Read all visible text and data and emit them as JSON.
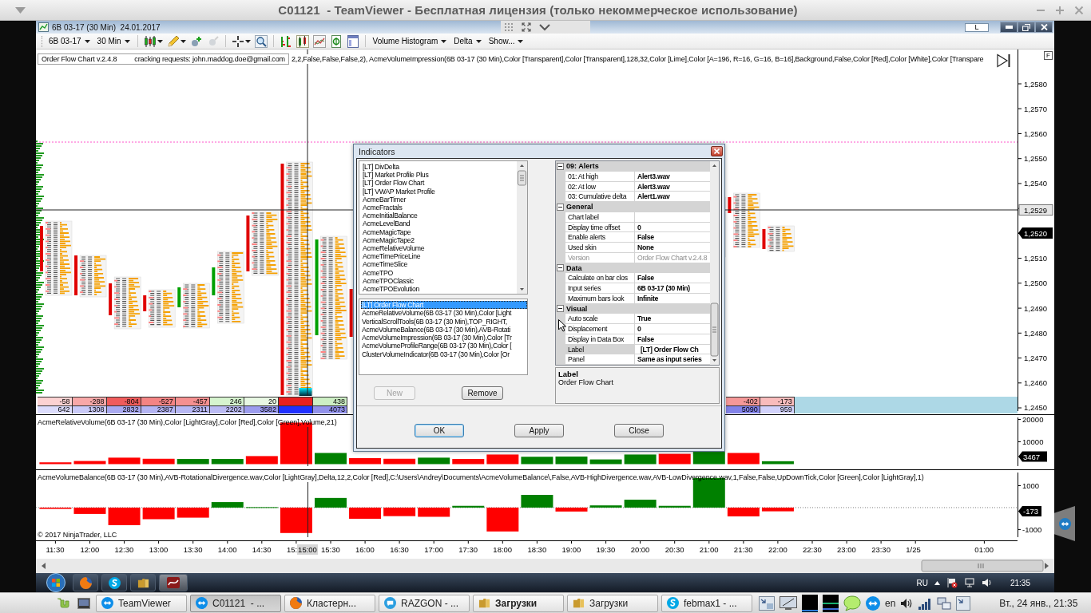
{
  "teamviewer_window": {
    "title": "C01121  - TeamViewer - Бесплатная лицензия (только некоммерческое использование)"
  },
  "chart_window": {
    "title": "6B 03-17 (30 Min)  24.01.2017",
    "layout_button": "L"
  },
  "toolbar": {
    "instrument": "6B 03-17",
    "interval": "30 Min",
    "menus": [
      "Volume Histogram",
      "Delta",
      "Show..."
    ]
  },
  "price_panel": {
    "indicator_box": [
      "Order Flow Chart v.2.4.8",
      "cracking requests: john.maddog.doe@gmail.com"
    ],
    "parameters": "2,2,False,False,False,2), AcmeVolumeImpression(6B 03-17 (30 Min),Color [Transparent],Color [Transparent],128,32,Color [Lime],Color [A=196, R=16, G=16, B=16],Background,False,Color [Red],Color [White],Color [Transpare",
    "corner_label": "F",
    "price_axis": {
      "upper": [
        "1,2580",
        "1,2570",
        "1,2560",
        "1,2550",
        "1,2540"
      ],
      "lower": [
        "1,2510",
        "1,2500",
        "1,2490",
        "1,2480",
        "1,2470",
        "1,2460",
        "1,2450"
      ]
    },
    "crosshair_price": "1,2529",
    "last_price": "1,2520",
    "delta_row": {
      "left": [
        {
          "text": "-58",
          "color": "#fcd2d2"
        },
        {
          "text": "-288",
          "color": "#f8a8a8"
        },
        {
          "text": "-804",
          "color": "#f05c5c"
        },
        {
          "text": "-527",
          "color": "#f48484"
        },
        {
          "text": "-457",
          "color": "#f59090"
        },
        {
          "text": "246",
          "color": "#d6f4cf"
        },
        {
          "text": "20",
          "color": "#e8f8e3"
        },
        {
          "color": "#e82020"
        },
        {
          "text": "438",
          "color": "#cdefc4"
        }
      ],
      "right": [
        {
          "text": "-402",
          "color": "#f59898"
        },
        {
          "text": "-173",
          "color": "#f9bcbc"
        }
      ]
    },
    "volume_row": {
      "left": [
        {
          "text": "642",
          "color": "#dcdcfc"
        },
        {
          "text": "1308",
          "color": "#cacaf8"
        },
        {
          "text": "2832",
          "color": "#a9a9f0"
        },
        {
          "text": "2387",
          "color": "#b4b4f3"
        },
        {
          "text": "2311",
          "color": "#b7b7f3"
        },
        {
          "text": "2202",
          "color": "#bbbbf4"
        },
        {
          "text": "3582",
          "color": "#9c9cee"
        },
        {
          "color": "#2030ff"
        },
        {
          "text": "4073",
          "color": "#9292eb"
        }
      ],
      "right": [
        {
          "text": "5090",
          "color": "#8282e8"
        },
        {
          "text": "959",
          "color": "#d2d2fb"
        }
      ]
    }
  },
  "relative_volume_panel": {
    "label": "AcmeRelativeVolume(6B 03-17 (30 Min),Color [LightGray],Color [Red],Color [Green],Volume,21)",
    "last_value": "3467",
    "chart_data": {
      "type": "bar",
      "x": [
        "2017-01-24T11:30",
        "2017-01-24T12:00",
        "2017-01-24T12:30",
        "2017-01-24T13:00",
        "2017-01-24T13:30",
        "2017-01-24T14:00",
        "2017-01-24T14:30",
        "2017-01-24T15:00",
        "2017-01-24T15:30",
        "2017-01-24T16:00",
        "2017-01-24T16:30",
        "2017-01-24T17:00",
        "2017-01-24T17:30",
        "2017-01-24T18:00",
        "2017-01-24T18:30",
        "2017-01-24T19:00",
        "2017-01-24T19:30",
        "2017-01-24T20:00",
        "2017-01-24T20:30",
        "2017-01-24T21:00",
        "2017-01-24T21:30",
        "2017-01-24T22:00"
      ],
      "xlim": [
        "2017-01-24T11:13",
        "2017-01-25T01:29"
      ],
      "values": [
        800,
        1400,
        2900,
        2400,
        2300,
        2300,
        3600,
        18600,
        5000,
        2700,
        2400,
        2900,
        2300,
        4300,
        3300,
        3400,
        2100,
        4300,
        4600,
        5500,
        5000,
        1300
      ],
      "colors": [
        "#ff0000",
        "#ff0000",
        "#ff0000",
        "#ff0000",
        "#008000",
        "#008000",
        "#ff0000",
        "#ff0000",
        "#008000",
        "#ff0000",
        "#ff0000",
        "#008000",
        "#ff0000",
        "#ff0000",
        "#008000",
        "#008000",
        "#008000",
        "#008000",
        "#ff0000",
        "#008000",
        "#ff0000",
        "#008000"
      ],
      "ylim": [
        -900,
        20900
      ],
      "yticks": [
        10000,
        20000
      ],
      "tick_labels": "y"
    }
  },
  "volume_balance_panel": {
    "label": "AcmeVolumeBalance(6B 03-17 (30 Min),AVB-RotationalDivergence.wav,Color [LightGray],Delta,12,2,Color [Red],C:\\Users\\Andrey\\Documents\\AcmeVolumeBalance\\,False,AVB-HighDivergence.wav,AVB-LowDivergence.wav,1,False,False,UpDownTick,Color [Green],Color [LightGray],1)",
    "copyright": "© 2017 NinjaTrader, LLC",
    "last_value": "-173",
    "crosshair_time": "15:00",
    "chart_data": {
      "type": "bar",
      "x": [
        "2017-01-24T11:30",
        "2017-01-24T12:00",
        "2017-01-24T12:30",
        "2017-01-24T13:00",
        "2017-01-24T13:30",
        "2017-01-24T14:00",
        "2017-01-24T14:30",
        "2017-01-24T15:00",
        "2017-01-24T15:30",
        "2017-01-24T16:00",
        "2017-01-24T16:30",
        "2017-01-24T17:00",
        "2017-01-24T17:30",
        "2017-01-24T18:00",
        "2017-01-24T18:30",
        "2017-01-24T19:00",
        "2017-01-24T19:30",
        "2017-01-24T20:00",
        "2017-01-24T20:30",
        "2017-01-24T21:00",
        "2017-01-24T21:30",
        "2017-01-24T22:00"
      ],
      "xlim": [
        "2017-01-24T11:13",
        "2017-01-25T01:29"
      ],
      "xticks": [
        {
          "value": "2017-01-24T11:30",
          "label": "11:30"
        },
        {
          "value": "2017-01-24T12:00",
          "label": "12:00"
        },
        {
          "value": "2017-01-24T12:30",
          "label": "12:30"
        },
        {
          "value": "2017-01-24T13:00",
          "label": "13:00"
        },
        {
          "value": "2017-01-24T13:30",
          "label": "13:30"
        },
        {
          "value": "2017-01-24T14:00",
          "label": "14:00"
        },
        {
          "value": "2017-01-24T14:30",
          "label": "14:30"
        },
        {
          "value": "2017-01-24T15:00",
          "label": "15:"
        },
        {
          "value": "2017-01-24T15:30",
          "label": "15:30"
        },
        {
          "value": "2017-01-24T16:00",
          "label": "16:00"
        },
        {
          "value": "2017-01-24T16:30",
          "label": "16:30"
        },
        {
          "value": "2017-01-24T17:00",
          "label": "17:00"
        },
        {
          "value": "2017-01-24T17:30",
          "label": "17:30"
        },
        {
          "value": "2017-01-24T18:00",
          "label": "18:00"
        },
        {
          "value": "2017-01-24T18:30",
          "label": "18:30"
        },
        {
          "value": "2017-01-24T19:00",
          "label": "19:00"
        },
        {
          "value": "2017-01-24T19:30",
          "label": "19:30"
        },
        {
          "value": "2017-01-24T20:00",
          "label": "20:00"
        },
        {
          "value": "2017-01-24T20:30",
          "label": "20:30"
        },
        {
          "value": "2017-01-24T21:00",
          "label": "21:00"
        },
        {
          "value": "2017-01-24T21:30",
          "label": "21:30"
        },
        {
          "value": "2017-01-24T22:00",
          "label": "22:00"
        },
        {
          "value": "2017-01-24T22:30",
          "label": "22:30"
        },
        {
          "value": "2017-01-24T23:00",
          "label": "23:00"
        },
        {
          "value": "2017-01-24T23:30",
          "label": "23:30"
        },
        {
          "value": "2017-01-25T00:00",
          "label": "1/25"
        },
        {
          "value": "2017-01-25T01:00",
          "label": "01:00"
        }
      ],
      "values": [
        -60,
        -290,
        -800,
        -530,
        -460,
        250,
        20,
        -1160,
        440,
        -510,
        -390,
        -420,
        80,
        -1090,
        580,
        -180,
        100,
        360,
        80,
        1350,
        -400,
        -170
      ],
      "colors": [
        "#ff0000",
        "#ff0000",
        "#ff0000",
        "#ff0000",
        "#ff0000",
        "#008000",
        "#008000",
        "#ff0000",
        "#008000",
        "#ff0000",
        "#ff0000",
        "#ff0000",
        "#008000",
        "#ff0000",
        "#008000",
        "#ff0000",
        "#008000",
        "#008000",
        "#008000",
        "#008000",
        "#ff0000",
        "#ff0000"
      ],
      "ylim": [
        -1350,
        1600
      ],
      "yticks": [
        -1000,
        1000
      ],
      "ref_lines": [
        {
          "axis": "y",
          "value": 0,
          "color": "#808080",
          "line_style": "dotted"
        }
      ]
    }
  },
  "indicators_dialog": {
    "title": "Indicators",
    "available": [
      {
        "label": "[LT] DivDelta",
        "selected": false
      },
      {
        "label": "[LT] Market Profile Plus",
        "selected": false
      },
      {
        "label": "[LT] Order Flow Chart",
        "selected": false
      },
      {
        "label": "[LT] VWAP Market Profile",
        "selected": false
      },
      {
        "label": "AcmeBarTimer",
        "selected": false
      },
      {
        "label": "AcmeFractals",
        "selected": false
      },
      {
        "label": "AcmeInitialBalance",
        "selected": false
      },
      {
        "label": "AcmeLevelBand",
        "selected": false
      },
      {
        "label": "AcmeMagicTape",
        "selected": false
      },
      {
        "label": "AcmeMagicTape2",
        "selected": false
      },
      {
        "label": "AcmeRelativeVolume",
        "selected": false
      },
      {
        "label": "AcmeTimePriceLine",
        "selected": false
      },
      {
        "label": "AcmeTimeSlice",
        "selected": false
      },
      {
        "label": "AcmeTPO",
        "selected": false
      },
      {
        "label": "AcmeTPOClassic",
        "selected": false
      },
      {
        "label": "AcmeTPOEvolution",
        "selected": false
      }
    ],
    "applied": [
      {
        "label": "[LT] Order Flow Chart",
        "selected": true
      },
      {
        "label": "AcmeRelativeVolume(6B 03-17 (30 Min),Color [Light",
        "selected": false
      },
      {
        "label": "VerticalScrollTools(6B 03-17 (30 Min),TOP_RIGHT,",
        "selected": false
      },
      {
        "label": "AcmeVolumeBalance(6B 03-17 (30 Min),AVB-Rotati",
        "selected": false
      },
      {
        "label": "AcmeVolumeImpression(6B 03-17 (30 Min),Color [Tr",
        "selected": false
      },
      {
        "label": "AcmeVolumeProfileRange(6B 03-17 (30 Min),Color [",
        "selected": false
      },
      {
        "label": "ClusterVolumeIndicator(6B 03-17 (30 Min),Color [Or",
        "selected": false
      }
    ],
    "list_buttons": [
      {
        "label": "New",
        "disabled": true
      },
      {
        "label": "Remove",
        "disabled": false
      }
    ],
    "properties": [
      {
        "category": "09: Alerts",
        "expanded": true,
        "rows": [
          {
            "name": "01: At high",
            "value": "Alert3.wav",
            "selected": false,
            "disabled": false
          },
          {
            "name": "02: At low",
            "value": "Alert3.wav",
            "selected": false,
            "disabled": false
          },
          {
            "name": "03: Cumulative delta",
            "value": "Alert1.wav",
            "selected": false,
            "disabled": false
          }
        ]
      },
      {
        "category": "General",
        "expanded": true,
        "rows": [
          {
            "name": "Chart label",
            "selected": false,
            "disabled": false
          },
          {
            "name": "Display time offset",
            "value": "0",
            "selected": false,
            "disabled": false
          },
          {
            "name": "Enable alerts",
            "value": "False",
            "selected": false,
            "disabled": false
          },
          {
            "name": "Used skin",
            "value": "None",
            "selected": false,
            "disabled": false
          },
          {
            "name": "Version",
            "value": "Order Flow Chart v.2.4.8",
            "selected": false,
            "disabled": true
          }
        ]
      },
      {
        "category": "Data",
        "expanded": true,
        "rows": [
          {
            "name": "Calculate on bar clos",
            "value": "False",
            "selected": false,
            "disabled": false
          },
          {
            "name": "Input series",
            "value": "6B 03-17 (30 Min)",
            "selected": false,
            "disabled": false
          },
          {
            "name": "Maximum bars look",
            "value": "Infinite",
            "selected": false,
            "disabled": false
          }
        ]
      },
      {
        "category": "Visual",
        "expanded": true,
        "rows": [
          {
            "name": "Auto scale",
            "value": "True",
            "selected": false,
            "disabled": false
          },
          {
            "name": "Displacement",
            "value": "0",
            "selected": false,
            "disabled": false
          },
          {
            "name": "Display in Data Box",
            "value": "False",
            "selected": false,
            "disabled": false
          },
          {
            "name": "Label",
            "value": "[LT] Order Flow Ch",
            "selected": true,
            "disabled": false
          },
          {
            "name": "Panel",
            "value": "Same as input series",
            "selected": false,
            "disabled": false
          }
        ]
      }
    ],
    "description": {
      "title": "Label",
      "text": "Order Flow Chart"
    },
    "buttons": [
      {
        "label": "OK",
        "default": true
      },
      {
        "label": "Apply",
        "default": false
      },
      {
        "label": "Close",
        "default": false
      }
    ]
  },
  "windows_taskbar": {
    "language": "RU",
    "clock": "21:35"
  },
  "mint_panel": {
    "tasks": [
      {
        "label": "TeamViewer",
        "kind": "remote",
        "selected": false,
        "urgent": false
      },
      {
        "label": "C01121  - ...",
        "kind": "remote",
        "selected": true,
        "urgent": false
      },
      {
        "label": "Кластерн...",
        "kind": "browser",
        "selected": false,
        "urgent": false
      },
      {
        "label": "RAZGON - ...",
        "kind": "chat",
        "selected": false,
        "urgent": false
      },
      {
        "label": "Загрузки",
        "kind": "folder",
        "selected": false,
        "urgent": true
      },
      {
        "label": "Загрузки",
        "kind": "folder",
        "selected": false,
        "urgent": false
      },
      {
        "label": "febmax1 - ...",
        "kind": "messenger",
        "selected": false,
        "urgent": false
      }
    ],
    "keyboard_layout": "en",
    "clock": "Вт., 24 янв., 21:35"
  }
}
